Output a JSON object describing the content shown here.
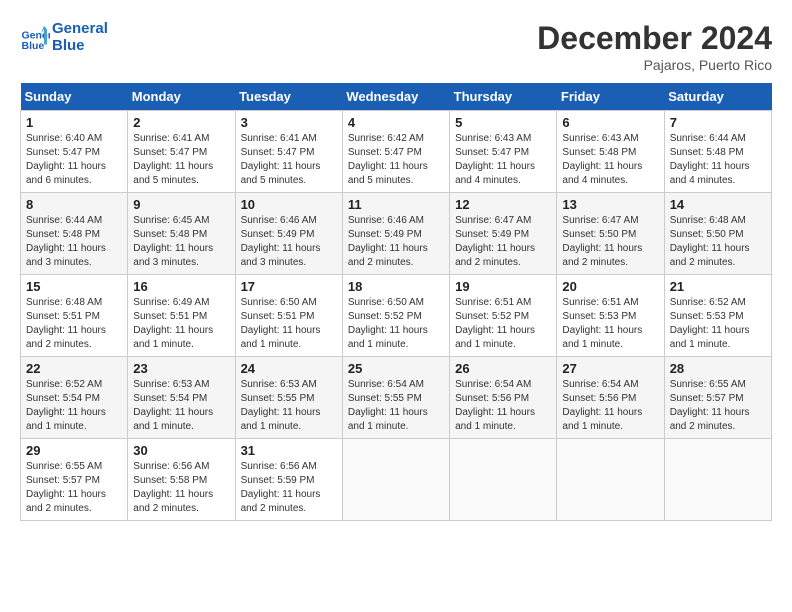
{
  "header": {
    "logo_line1": "General",
    "logo_line2": "Blue",
    "month": "December 2024",
    "location": "Pajaros, Puerto Rico"
  },
  "weekdays": [
    "Sunday",
    "Monday",
    "Tuesday",
    "Wednesday",
    "Thursday",
    "Friday",
    "Saturday"
  ],
  "weeks": [
    [
      {
        "day": "1",
        "sunrise": "6:40 AM",
        "sunset": "5:47 PM",
        "daylight": "11 hours and 6 minutes."
      },
      {
        "day": "2",
        "sunrise": "6:41 AM",
        "sunset": "5:47 PM",
        "daylight": "11 hours and 5 minutes."
      },
      {
        "day": "3",
        "sunrise": "6:41 AM",
        "sunset": "5:47 PM",
        "daylight": "11 hours and 5 minutes."
      },
      {
        "day": "4",
        "sunrise": "6:42 AM",
        "sunset": "5:47 PM",
        "daylight": "11 hours and 5 minutes."
      },
      {
        "day": "5",
        "sunrise": "6:43 AM",
        "sunset": "5:47 PM",
        "daylight": "11 hours and 4 minutes."
      },
      {
        "day": "6",
        "sunrise": "6:43 AM",
        "sunset": "5:48 PM",
        "daylight": "11 hours and 4 minutes."
      },
      {
        "day": "7",
        "sunrise": "6:44 AM",
        "sunset": "5:48 PM",
        "daylight": "11 hours and 4 minutes."
      }
    ],
    [
      {
        "day": "8",
        "sunrise": "6:44 AM",
        "sunset": "5:48 PM",
        "daylight": "11 hours and 3 minutes."
      },
      {
        "day": "9",
        "sunrise": "6:45 AM",
        "sunset": "5:48 PM",
        "daylight": "11 hours and 3 minutes."
      },
      {
        "day": "10",
        "sunrise": "6:46 AM",
        "sunset": "5:49 PM",
        "daylight": "11 hours and 3 minutes."
      },
      {
        "day": "11",
        "sunrise": "6:46 AM",
        "sunset": "5:49 PM",
        "daylight": "11 hours and 2 minutes."
      },
      {
        "day": "12",
        "sunrise": "6:47 AM",
        "sunset": "5:49 PM",
        "daylight": "11 hours and 2 minutes."
      },
      {
        "day": "13",
        "sunrise": "6:47 AM",
        "sunset": "5:50 PM",
        "daylight": "11 hours and 2 minutes."
      },
      {
        "day": "14",
        "sunrise": "6:48 AM",
        "sunset": "5:50 PM",
        "daylight": "11 hours and 2 minutes."
      }
    ],
    [
      {
        "day": "15",
        "sunrise": "6:48 AM",
        "sunset": "5:51 PM",
        "daylight": "11 hours and 2 minutes."
      },
      {
        "day": "16",
        "sunrise": "6:49 AM",
        "sunset": "5:51 PM",
        "daylight": "11 hours and 1 minute."
      },
      {
        "day": "17",
        "sunrise": "6:50 AM",
        "sunset": "5:51 PM",
        "daylight": "11 hours and 1 minute."
      },
      {
        "day": "18",
        "sunrise": "6:50 AM",
        "sunset": "5:52 PM",
        "daylight": "11 hours and 1 minute."
      },
      {
        "day": "19",
        "sunrise": "6:51 AM",
        "sunset": "5:52 PM",
        "daylight": "11 hours and 1 minute."
      },
      {
        "day": "20",
        "sunrise": "6:51 AM",
        "sunset": "5:53 PM",
        "daylight": "11 hours and 1 minute."
      },
      {
        "day": "21",
        "sunrise": "6:52 AM",
        "sunset": "5:53 PM",
        "daylight": "11 hours and 1 minute."
      }
    ],
    [
      {
        "day": "22",
        "sunrise": "6:52 AM",
        "sunset": "5:54 PM",
        "daylight": "11 hours and 1 minute."
      },
      {
        "day": "23",
        "sunrise": "6:53 AM",
        "sunset": "5:54 PM",
        "daylight": "11 hours and 1 minute."
      },
      {
        "day": "24",
        "sunrise": "6:53 AM",
        "sunset": "5:55 PM",
        "daylight": "11 hours and 1 minute."
      },
      {
        "day": "25",
        "sunrise": "6:54 AM",
        "sunset": "5:55 PM",
        "daylight": "11 hours and 1 minute."
      },
      {
        "day": "26",
        "sunrise": "6:54 AM",
        "sunset": "5:56 PM",
        "daylight": "11 hours and 1 minute."
      },
      {
        "day": "27",
        "sunrise": "6:54 AM",
        "sunset": "5:56 PM",
        "daylight": "11 hours and 1 minute."
      },
      {
        "day": "28",
        "sunrise": "6:55 AM",
        "sunset": "5:57 PM",
        "daylight": "11 hours and 2 minutes."
      }
    ],
    [
      {
        "day": "29",
        "sunrise": "6:55 AM",
        "sunset": "5:57 PM",
        "daylight": "11 hours and 2 minutes."
      },
      {
        "day": "30",
        "sunrise": "6:56 AM",
        "sunset": "5:58 PM",
        "daylight": "11 hours and 2 minutes."
      },
      {
        "day": "31",
        "sunrise": "6:56 AM",
        "sunset": "5:59 PM",
        "daylight": "11 hours and 2 minutes."
      },
      null,
      null,
      null,
      null
    ]
  ]
}
